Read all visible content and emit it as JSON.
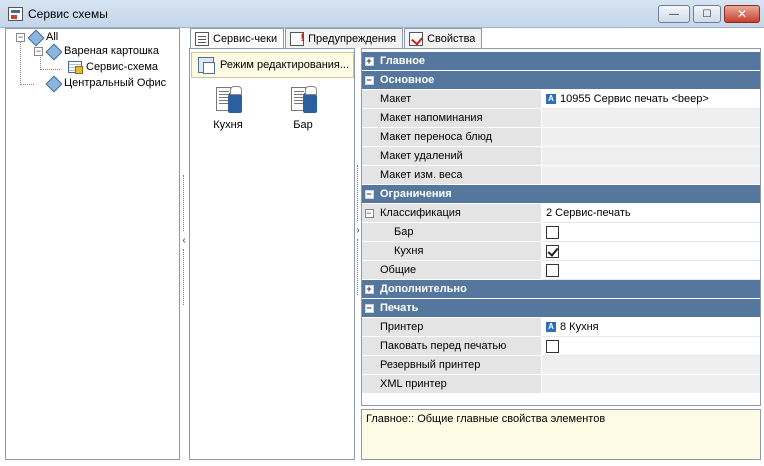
{
  "window": {
    "title": "Сервис схемы",
    "min_label": "—",
    "max_label": "☐",
    "close_label": "✕"
  },
  "tree": {
    "root": "All",
    "node1": "Вареная картошка",
    "node1_child": "Сервис-схема",
    "node2": "Центральный Офис"
  },
  "tabs": [
    "Сервис-чеки",
    "Предупреждения",
    "Свойства"
  ],
  "mode_button": "Режим редактирования...",
  "printers": [
    "Кухня",
    "Бар"
  ],
  "properties": {
    "cat_main": "Главное",
    "cat_basic": "Основное",
    "maket": "Макет",
    "maket_value": "10955 Сервис печать <beep>",
    "maket_reminder": "Макет напоминания",
    "maket_transfer": "Макет переноса блюд",
    "maket_delete": "Макет удалений",
    "maket_weight": "Макет изм. веса",
    "cat_limits": "Ограничения",
    "classification": "Классификация",
    "classification_value": "2 Сервис-печать",
    "bar": "Бар",
    "kitchen": "Кухня",
    "common": "Общие",
    "cat_additional": "Дополнительно",
    "cat_print": "Печать",
    "printer": "Принтер",
    "printer_value": "8 Кухня",
    "pack_before_print": "Паковать перед печатью",
    "backup_printer": "Резервный принтер",
    "xml_printer": "XML принтер",
    "value_badge": "A"
  },
  "checkboxes": {
    "bar": false,
    "kitchen": true,
    "common": false,
    "pack_before_print": false
  },
  "description": "Главное:: Общие главные свойства элементов"
}
